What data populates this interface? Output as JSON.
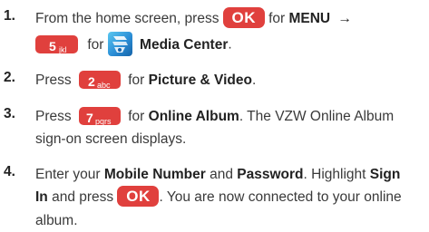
{
  "steps": [
    {
      "number": "1.",
      "line1": [
        "From the home screen, press",
        "for",
        "MENU",
        "→"
      ],
      "line2": [
        "for",
        "Media Center",
        "."
      ],
      "keys": {
        "ok": "OK",
        "five_digit": "5",
        "five_letters": "jkl"
      }
    },
    {
      "number": "2.",
      "parts": [
        "Press",
        "for",
        "Picture & Video",
        "."
      ],
      "keys": {
        "digit": "2",
        "letters": "abc"
      }
    },
    {
      "number": "3.",
      "parts": [
        "Press",
        "for",
        "Online Album",
        ". The VZW Online Album"
      ],
      "line2": "sign-on screen displays.",
      "keys": {
        "digit": "7",
        "letters": "pqrs"
      }
    },
    {
      "number": "4.",
      "line1": [
        "Enter your",
        "Mobile Number",
        "and",
        "Password",
        ". Highlight",
        "Sign"
      ],
      "line2": [
        "In",
        "and press",
        ". You are now connected to your online"
      ],
      "line3": "album.",
      "keys": {
        "ok": "OK"
      }
    }
  ],
  "icons": [
    "ok-key-icon",
    "key-5-jkl-icon",
    "media-center-icon",
    "key-2-abc-icon",
    "key-7-pqrs-icon"
  ],
  "colors": {
    "key": "#e0403d",
    "text": "#3a3a3a",
    "media_center": "#2b8ed6"
  }
}
